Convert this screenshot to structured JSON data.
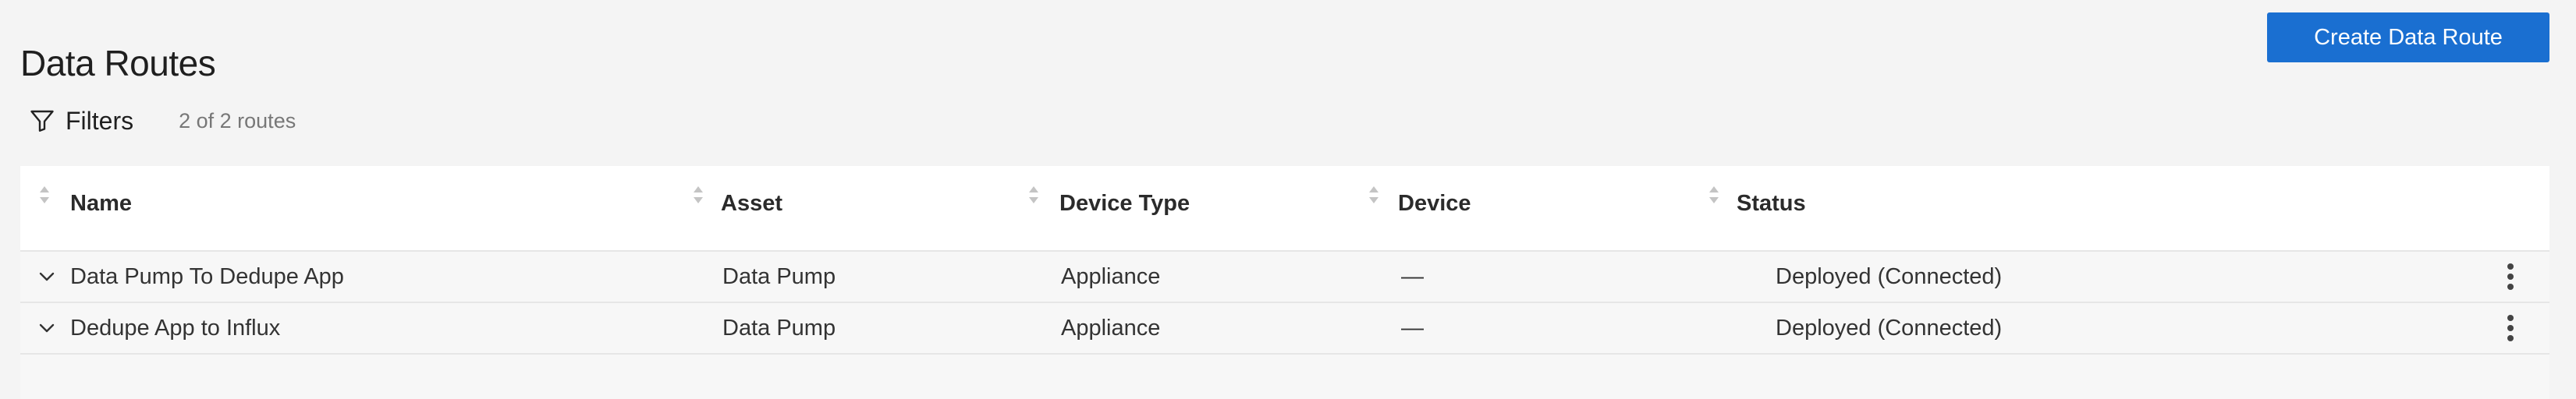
{
  "header": {
    "title": "Data Routes",
    "create_button_label": "Create Data Route"
  },
  "filters": {
    "label": "Filters",
    "count_text": "2 of 2 routes"
  },
  "table": {
    "columns": [
      "Name",
      "Asset",
      "Device Type",
      "Device",
      "Status"
    ],
    "rows": [
      {
        "name": "Data Pump To Dedupe App",
        "asset": "Data Pump",
        "device_type": "Appliance",
        "device": "—",
        "status": "Deployed (Connected)"
      },
      {
        "name": "Dedupe App to Influx",
        "asset": "Data Pump",
        "device_type": "Appliance",
        "device": "—",
        "status": "Deployed (Connected)"
      }
    ]
  },
  "colors": {
    "primary": "#1a6fd1",
    "background": "#f4f4f4",
    "header_background": "#ffffff"
  },
  "icons": {
    "filter": "funnel-icon",
    "sort": "sort-icon",
    "expand": "chevron-down-icon",
    "row_menu": "kebab-menu-icon"
  }
}
